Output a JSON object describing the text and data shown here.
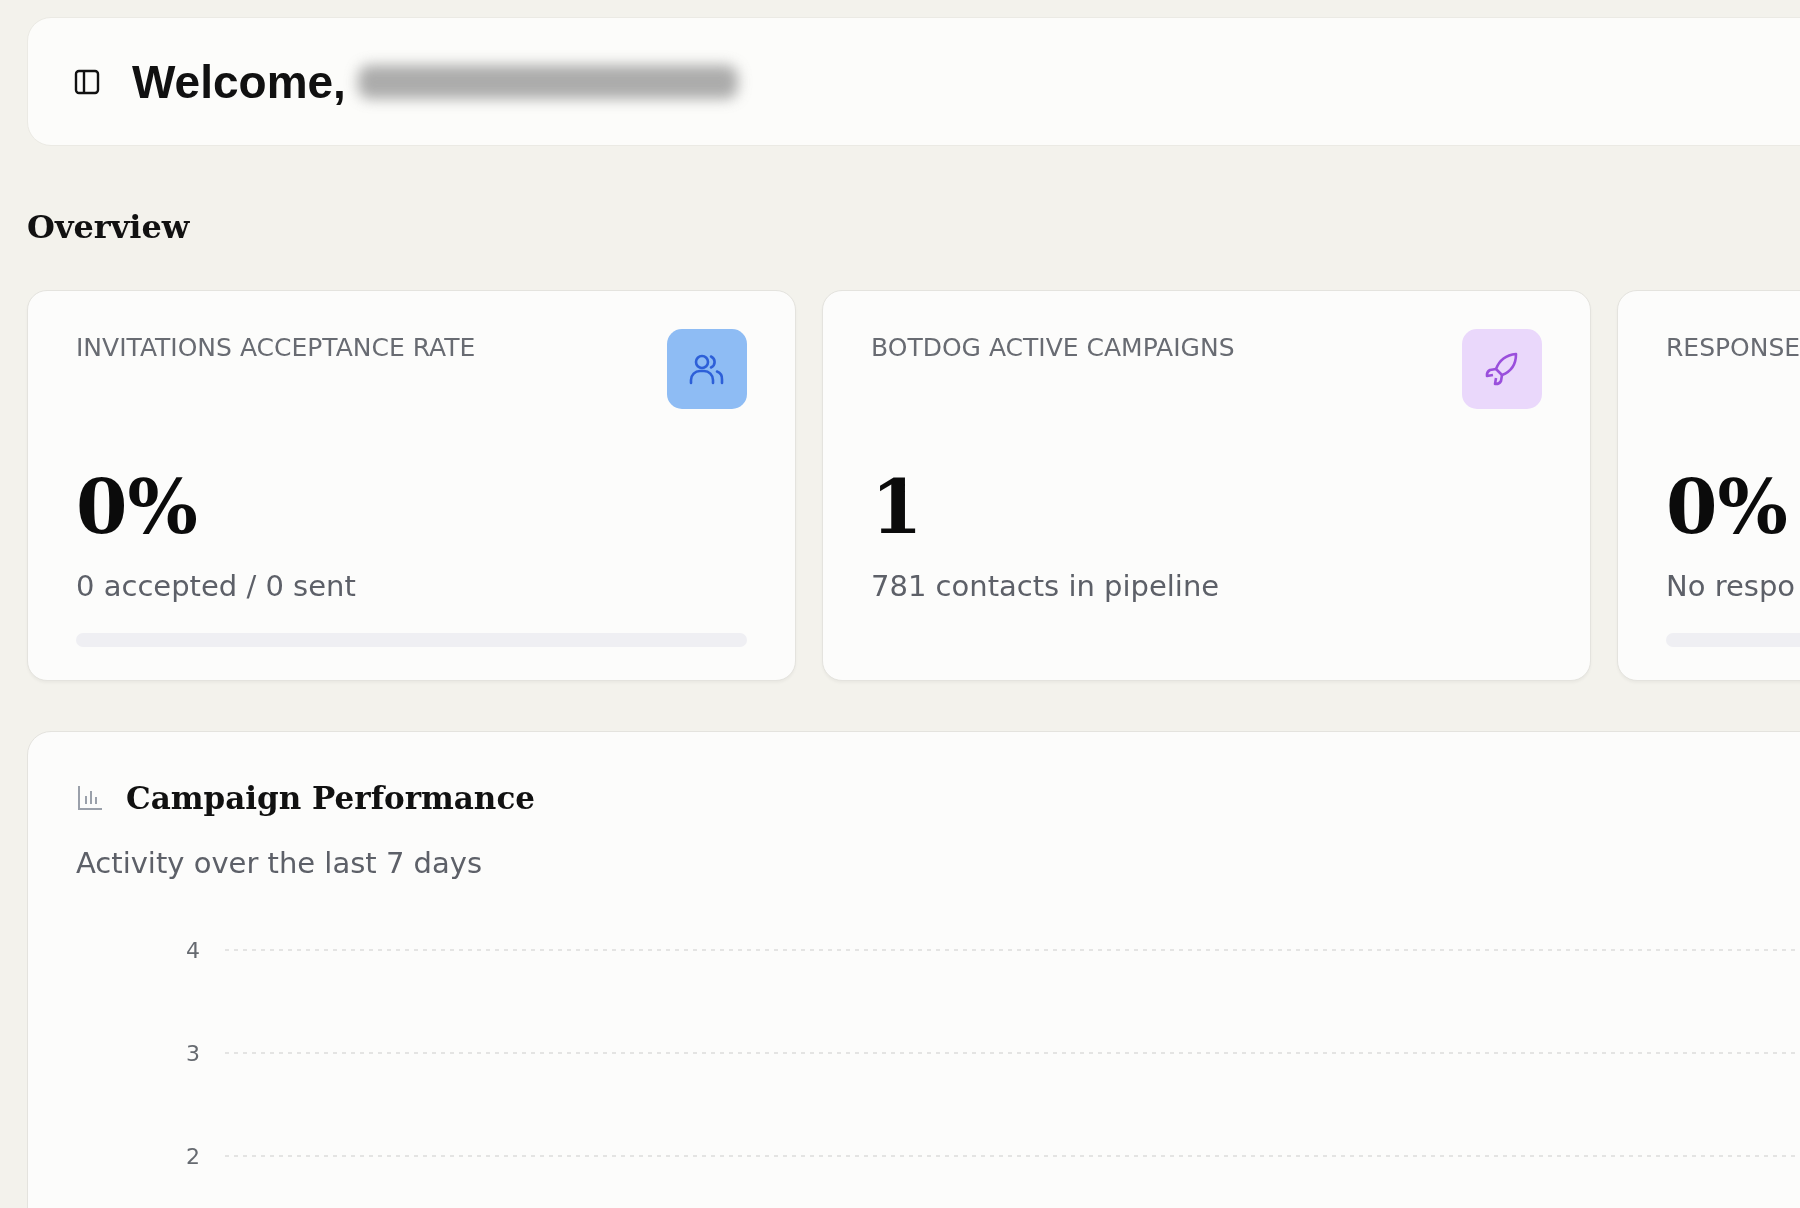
{
  "header": {
    "greeting": "Welcome,",
    "name_redacted": true
  },
  "overview": {
    "title": "Overview",
    "cards": [
      {
        "kind": "acceptance",
        "label": "INVITATIONS ACCEPTANCE RATE",
        "value": "0%",
        "detail": "0 accepted / 0 sent",
        "level": 0
      },
      {
        "kind": "campaigns",
        "label": "BOTDOG ACTIVE CAMPAIGNS",
        "value": "1",
        "detail": "781 contacts in pipeline"
      },
      {
        "kind": "response",
        "label": "RESPONSE",
        "value": "0%",
        "detail": "No respo",
        "level": 0
      }
    ]
  },
  "performance": {
    "title": "Campaign Performance",
    "subtitle": "Activity over the last 7 days",
    "y_axis_ticks": [
      "4",
      "3",
      "2"
    ]
  }
}
